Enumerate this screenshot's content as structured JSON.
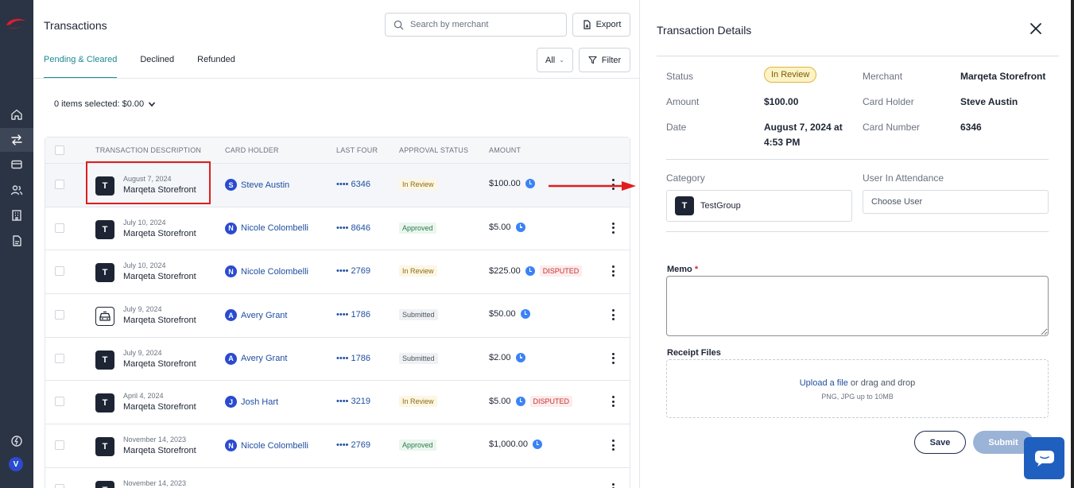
{
  "main": {
    "title": "Transactions",
    "search_placeholder": "Search by merchant",
    "export_label": "Export",
    "tabs": [
      {
        "label": "Pending & Cleared"
      },
      {
        "label": "Declined"
      },
      {
        "label": "Refunded"
      }
    ],
    "all_select": "All",
    "filter_label": "Filter",
    "items_selected": "0 items selected: $0.00"
  },
  "table": {
    "headers": [
      "TRANSACTION DESCRIPTION",
      "CARD HOLDER",
      "LAST FOUR",
      "APPROVAL STATUS",
      "AMOUNT"
    ],
    "rows": [
      {
        "badge": "T",
        "date": "August 7, 2024",
        "merchant": "Marqeta Storefront",
        "initial": "S",
        "holder": "Steve Austin",
        "last4": "•••• 6346",
        "status": "In Review",
        "amount": "$100.00",
        "disputed": ""
      },
      {
        "badge": "T",
        "date": "July 10, 2024",
        "merchant": "Marqeta Storefront",
        "initial": "N",
        "holder": "Nicole Colombelli",
        "last4": "•••• 8646",
        "status": "Approved",
        "amount": "$5.00",
        "disputed": ""
      },
      {
        "badge": "T",
        "date": "July 10, 2024",
        "merchant": "Marqeta Storefront",
        "initial": "N",
        "holder": "Nicole Colombelli",
        "last4": "•••• 2769",
        "status": "In Review",
        "amount": "$225.00",
        "disputed": "DISPUTED"
      },
      {
        "badge": "",
        "date": "July 9, 2024",
        "merchant": "Marqeta Storefront",
        "initial": "A",
        "holder": "Avery Grant",
        "last4": "•••• 1786",
        "status": "Submitted",
        "amount": "$50.00",
        "disputed": ""
      },
      {
        "badge": "T",
        "date": "July 9, 2024",
        "merchant": "Marqeta Storefront",
        "initial": "A",
        "holder": "Avery Grant",
        "last4": "•••• 1786",
        "status": "Submitted",
        "amount": "$2.00",
        "disputed": ""
      },
      {
        "badge": "T",
        "date": "April 4, 2024",
        "merchant": "Marqeta Storefront",
        "initial": "J",
        "holder": "Josh Hart",
        "last4": "•••• 3219",
        "status": "In Review",
        "amount": "$5.00",
        "disputed": "DISPUTED"
      },
      {
        "badge": "T",
        "date": "November 14, 2023",
        "merchant": "Marqeta Storefront",
        "initial": "N",
        "holder": "Nicole Colombelli",
        "last4": "•••• 2769",
        "status": "Approved",
        "amount": "$1,000.00",
        "disputed": ""
      },
      {
        "badge": "T",
        "date": "November 14, 2023",
        "merchant": "",
        "initial": "",
        "holder": "",
        "last4": "",
        "status": "",
        "amount": "",
        "disputed": ""
      }
    ]
  },
  "details": {
    "title": "Transaction Details",
    "status_label": "Status",
    "status_value": "In Review",
    "amount_label": "Amount",
    "amount_value": "$100.00",
    "date_label": "Date",
    "date_value_line1": "August 7, 2024 at",
    "date_value_line2": "4:53 PM",
    "merchant_label": "Merchant",
    "merchant_value": "Marqeta Storefront",
    "holder_label": "Card Holder",
    "holder_value": "Steve Austin",
    "card_label": "Card Number",
    "card_value": "6346",
    "category_label": "Category",
    "category_badge": "T",
    "category_value": "TestGroup",
    "attendance_label": "User In Attendance",
    "attendance_placeholder": "Choose User",
    "memo_label": "Memo",
    "memo_required": "*",
    "receipt_label": "Receipt Files",
    "upload_link": "Upload a file",
    "upload_rest": " or drag and drop",
    "upload_hint": "PNG, JPG up to 10MB",
    "save_label": "Save",
    "submit_label": "Submit"
  },
  "rail": {
    "avatar_initial": "V"
  },
  "colors": {
    "accent_teal": "#1b8a94",
    "annotation_red": "#e11d1d",
    "rail_bg": "#2b3444",
    "chat_blue": "#1f5fbf"
  }
}
